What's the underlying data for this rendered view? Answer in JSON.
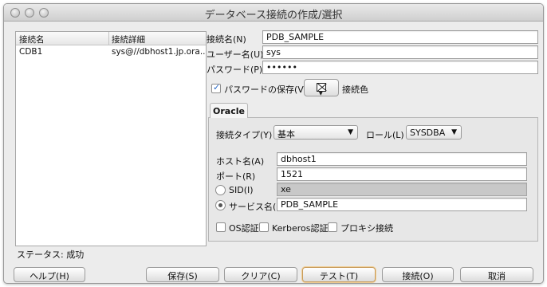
{
  "window": {
    "title": "データベース接続の作成/選択"
  },
  "connections": {
    "headers": [
      "接続名",
      "接続詳細"
    ],
    "rows": [
      {
        "name": "CDB1",
        "details": "sys@//dbhost1.jp.ora..."
      }
    ]
  },
  "status": "ステータス: 成功",
  "form": {
    "conn_name_label": "接続名(N)",
    "conn_name_value": "PDB_SAMPLE",
    "user_label": "ユーザー名(U)",
    "user_value": "sys",
    "password_label": "パスワード(P)",
    "password_value": "••••••",
    "save_password_label": "パスワードの保存(V)",
    "save_password_checked": true,
    "color_label": "接続色"
  },
  "tab": {
    "label": "Oracle"
  },
  "oracle": {
    "conn_type_label": "接続タイプ(Y)",
    "conn_type_value": "基本",
    "role_label": "ロール(L)",
    "role_value": "SYSDBA",
    "host_label": "ホスト名(A)",
    "host_value": "dbhost1",
    "port_label": "ポート(R)",
    "port_value": "1521",
    "sid_label": "SID(I)",
    "sid_value": "xe",
    "service_label": "サービス名(E)",
    "service_value": "PDB_SAMPLE",
    "os_auth_label": "OS認証",
    "kerberos_label": "Kerberos認証",
    "proxy_label": "プロキシ接続"
  },
  "buttons": {
    "help": "ヘルプ(H)",
    "save": "保存(S)",
    "clear": "クリア(C)",
    "test": "テスト(T)",
    "connect": "接続(O)",
    "cancel": "取消"
  },
  "icons": {
    "window_controls": [
      "close-button",
      "minimize-button",
      "zoom-button"
    ],
    "color_picker": "no-color-icon"
  }
}
